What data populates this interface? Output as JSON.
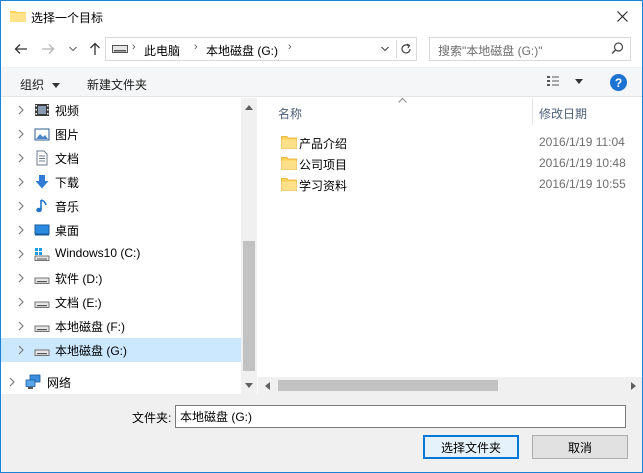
{
  "window": {
    "title": "选择一个目标"
  },
  "address": {
    "crumbs": [
      "此电脑",
      "本地磁盘 (G:)"
    ],
    "search_placeholder": "搜索\"本地磁盘 (G:)\""
  },
  "toolbar": {
    "organize": "组织",
    "new_folder": "新建文件夹"
  },
  "nav_tree": [
    {
      "label": "视频",
      "icon": "video-icon"
    },
    {
      "label": "图片",
      "icon": "picture-icon"
    },
    {
      "label": "文档",
      "icon": "document-icon"
    },
    {
      "label": "下载",
      "icon": "download-icon"
    },
    {
      "label": "音乐",
      "icon": "music-icon"
    },
    {
      "label": "桌面",
      "icon": "desktop-icon"
    },
    {
      "label": "Windows10 (C:)",
      "icon": "system-drive-icon"
    },
    {
      "label": "软件 (D:)",
      "icon": "drive-icon"
    },
    {
      "label": "文档 (E:)",
      "icon": "drive-icon"
    },
    {
      "label": "本地磁盘 (F:)",
      "icon": "drive-icon"
    },
    {
      "label": "本地磁盘 (G:)",
      "icon": "drive-icon",
      "selected": true
    },
    {
      "label": "网络",
      "icon": "network-icon"
    }
  ],
  "columns": {
    "name": "名称",
    "modified": "修改日期"
  },
  "files": [
    {
      "name": "产品介绍",
      "modified": "2016/1/19 11:04"
    },
    {
      "name": "公司项目",
      "modified": "2016/1/19 10:48"
    },
    {
      "name": "学习资料",
      "modified": "2016/1/19 10:55"
    }
  ],
  "bottom": {
    "folder_label": "文件夹:",
    "folder_value": "本地磁盘 (G:)",
    "select_button": "选择文件夹",
    "cancel_button": "取消"
  },
  "colors": {
    "accent": "#0078d7",
    "selection": "#cce8ff",
    "folder": "#ffd35a"
  }
}
